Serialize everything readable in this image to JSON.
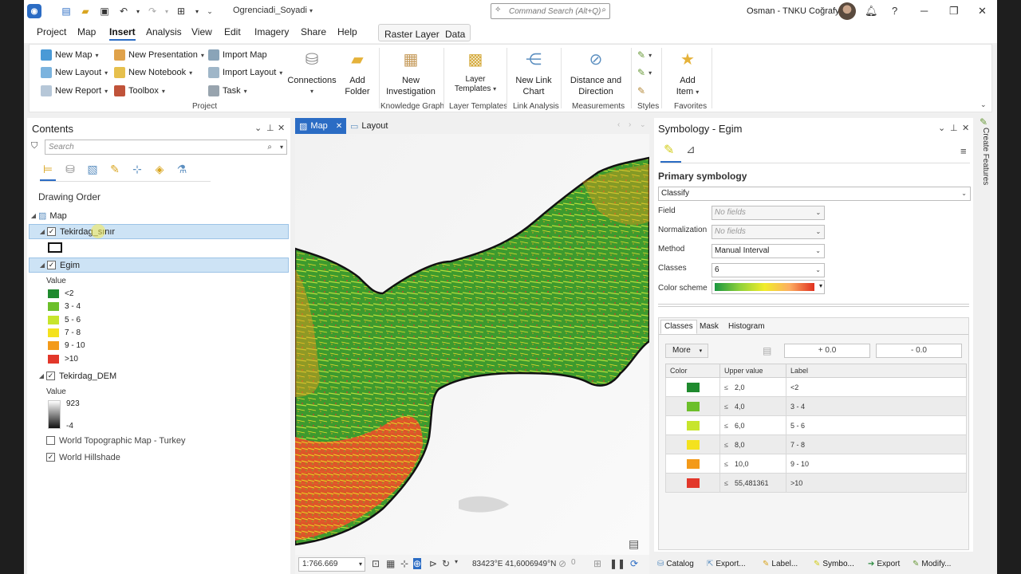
{
  "title_bar": {
    "document_title": "Ogrenciadi_Soyadi",
    "command_search_placeholder": "Command Search (Alt+Q)",
    "user_name": "Osman - TNKU Coğrafya",
    "help": "?"
  },
  "ribbon_tabs": [
    "Project",
    "Map",
    "Insert",
    "Analysis",
    "View",
    "Edit",
    "Imagery",
    "Share",
    "Help"
  ],
  "context_tabs": [
    "Raster Layer",
    "Data"
  ],
  "ribbon": {
    "project": {
      "new_map": "New Map",
      "new_layout": "New Layout",
      "new_report": "New Report",
      "new_presentation": "New Presentation",
      "new_notebook": "New Notebook",
      "toolbox": "Toolbox",
      "import_map": "Import Map",
      "import_layout": "Import Layout",
      "task": "Task",
      "connections": "Connections",
      "add_folder_1": "Add",
      "add_folder_2": "Folder",
      "group": "Project"
    },
    "knowledge_graph": {
      "label_1": "New",
      "label_2": "Investigation",
      "group": "Knowledge Graph"
    },
    "layer_templates": {
      "label_1": "Layer",
      "label_2": "Templates",
      "group": "Layer Templates"
    },
    "link_analysis": {
      "label_1": "New Link",
      "label_2": "Chart",
      "group": "Link Analysis"
    },
    "measurements": {
      "label_1": "Distance and",
      "label_2": "Direction",
      "group": "Measurements"
    },
    "styles": {
      "group": "Styles"
    },
    "favorites": {
      "label_1": "Add",
      "label_2": "Item",
      "group": "Favorites"
    }
  },
  "contents": {
    "title": "Contents",
    "search_placeholder": "Search",
    "drawing_order": "Drawing Order",
    "map_node": "Map",
    "layer1": "Tekirdag_sınır",
    "layer2": "Egim",
    "layer2_value_label": "Value",
    "layer2_legend": [
      {
        "label": "<2",
        "color": "#1f8a2e"
      },
      {
        "label": "3 - 4",
        "color": "#6cbf2a"
      },
      {
        "label": "5 - 6",
        "color": "#c7e52d"
      },
      {
        "label": "7 - 8",
        "color": "#f4e21e"
      },
      {
        "label": "9 - 10",
        "color": "#f39a1a"
      },
      {
        "label": ">10",
        "color": "#e2372a"
      }
    ],
    "layer3": "Tekirdag_DEM",
    "layer3_value_label": "Value",
    "layer3_max": "923",
    "layer3_min": "-4",
    "layer4": "World Topographic Map - Turkey",
    "layer5": "World Hillshade"
  },
  "map_view": {
    "tab_map": "Map",
    "tab_layout": "Layout",
    "scale": "1:766.669",
    "coordinates": "83423°E 41,6006949°N",
    "selected_count": "0"
  },
  "symbology": {
    "title": "Symbology - Egim",
    "primary": "Primary symbology",
    "method_type": "Classify",
    "field_label": "Field",
    "field_value": "No fields",
    "normalization_label": "Normalization",
    "normalization_value": "No fields",
    "method_label": "Method",
    "method_value": "Manual Interval",
    "classes_label": "Classes",
    "classes_value": "6",
    "color_scheme_label": "Color scheme",
    "tabs": [
      "Classes",
      "Mask",
      "Histogram"
    ],
    "more": "More",
    "plus": "+ 0.0",
    "minus": "- 0.0",
    "col_color": "Color",
    "col_upper": "Upper value",
    "col_label": "Label",
    "rows": [
      {
        "upper": "2,0",
        "label": "<2",
        "color": "#1f8a2e"
      },
      {
        "upper": "4,0",
        "label": "3 - 4",
        "color": "#6cbf2a"
      },
      {
        "upper": "6,0",
        "label": "5 - 6",
        "color": "#c7e52d"
      },
      {
        "upper": "8,0",
        "label": "7 - 8",
        "color": "#f4e21e"
      },
      {
        "upper": "10,0",
        "label": "9 - 10",
        "color": "#f39a1a"
      },
      {
        "upper": "55,481361",
        "label": ">10",
        "color": "#e2372a"
      }
    ],
    "le_symbol": "≤"
  },
  "side_strip": {
    "create_features": "Create Features"
  },
  "bottom_tabs": [
    "Catalog",
    "Export...",
    "Label...",
    "Symbo...",
    "Export",
    "Modify..."
  ]
}
